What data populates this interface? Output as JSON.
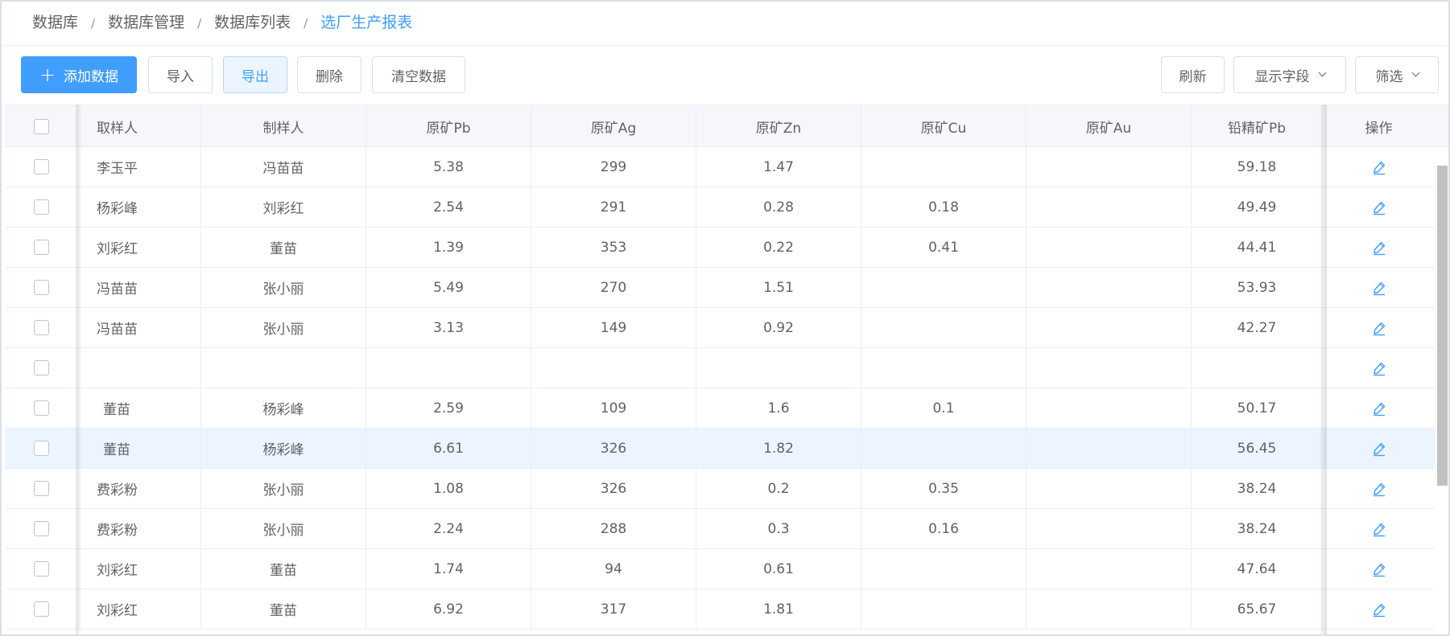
{
  "breadcrumb": [
    {
      "label": "数据库"
    },
    {
      "label": "数据库管理"
    },
    {
      "label": "数据库列表"
    },
    {
      "label": "选厂生产报表"
    }
  ],
  "breadcrumb_separator": "/",
  "toolbar": {
    "add_label": "添加数据",
    "import_label": "导入",
    "export_label": "导出",
    "delete_label": "删除",
    "clear_label": "清空数据",
    "refresh_label": "刷新",
    "fields_label": "显示字段",
    "filter_label": "筛选"
  },
  "columns": [
    "取样人",
    "制样人",
    "原矿Pb",
    "原矿Ag",
    "原矿Zn",
    "原矿Cu",
    "原矿Au",
    "铅精矿Pb"
  ],
  "actions_header": "操作",
  "rows": [
    {
      "sampler": "李玉平",
      "preparer": "冯苗苗",
      "pb": "5.38",
      "ag": "299",
      "zn": "1.47",
      "cu": "",
      "au": "",
      "conc_pb": "59.18"
    },
    {
      "sampler": "杨彩峰",
      "preparer": "刘彩红",
      "pb": "2.54",
      "ag": "291",
      "zn": "0.28",
      "cu": "0.18",
      "au": "",
      "conc_pb": "49.49"
    },
    {
      "sampler": "刘彩红",
      "preparer": "董苗",
      "pb": "1.39",
      "ag": "353",
      "zn": "0.22",
      "cu": "0.41",
      "au": "",
      "conc_pb": "44.41"
    },
    {
      "sampler": "冯苗苗",
      "preparer": "张小丽",
      "pb": "5.49",
      "ag": "270",
      "zn": "1.51",
      "cu": "",
      "au": "",
      "conc_pb": "53.93"
    },
    {
      "sampler": "冯苗苗",
      "preparer": "张小丽",
      "pb": "3.13",
      "ag": "149",
      "zn": "0.92",
      "cu": "",
      "au": "",
      "conc_pb": "42.27"
    },
    {
      "sampler": "",
      "preparer": "",
      "pb": "",
      "ag": "",
      "zn": "",
      "cu": "",
      "au": "",
      "conc_pb": ""
    },
    {
      "sampler": "董苗",
      "preparer": "杨彩峰",
      "pb": "2.59",
      "ag": "109",
      "zn": "1.6",
      "cu": "0.1",
      "au": "",
      "conc_pb": "50.17"
    },
    {
      "sampler": "董苗",
      "preparer": "杨彩峰",
      "pb": "6.61",
      "ag": "326",
      "zn": "1.82",
      "cu": "",
      "au": "",
      "conc_pb": "56.45",
      "hover": true
    },
    {
      "sampler": "费彩粉",
      "preparer": "张小丽",
      "pb": "1.08",
      "ag": "326",
      "zn": "0.2",
      "cu": "0.35",
      "au": "",
      "conc_pb": "38.24"
    },
    {
      "sampler": "费彩粉",
      "preparer": "张小丽",
      "pb": "2.24",
      "ag": "288",
      "zn": "0.3",
      "cu": "0.16",
      "au": "",
      "conc_pb": "38.24"
    },
    {
      "sampler": "刘彩红",
      "preparer": "董苗",
      "pb": "1.74",
      "ag": "94",
      "zn": "0.61",
      "cu": "",
      "au": "",
      "conc_pb": "47.64"
    },
    {
      "sampler": "刘彩红",
      "preparer": "董苗",
      "pb": "6.92",
      "ag": "317",
      "zn": "1.81",
      "cu": "",
      "au": "",
      "conc_pb": "65.67"
    }
  ],
  "colors": {
    "primary": "#409eff",
    "primary_light": "#ecf5ff",
    "text": "#606266",
    "border": "#ebeef5",
    "header_bg": "#f5f7fa",
    "row_hover": "#ecf5ff"
  },
  "icons": {
    "edit": "edit-icon",
    "add": "plus-icon",
    "dropdown": "chevron-down-icon"
  }
}
